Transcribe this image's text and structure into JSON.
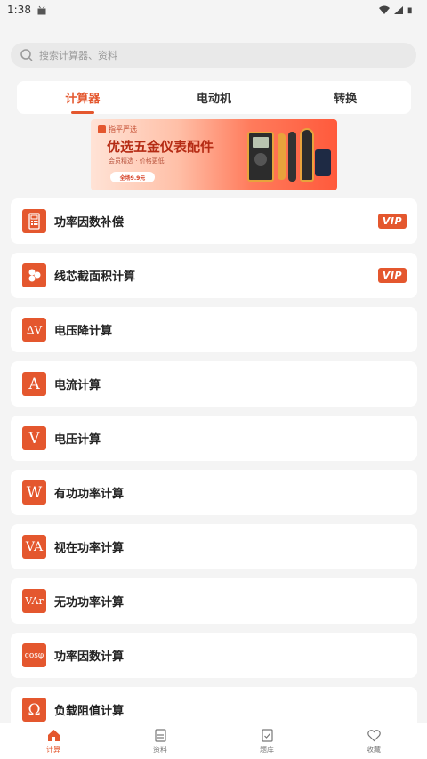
{
  "status": {
    "time": "1:38"
  },
  "search": {
    "placeholder": "搜索计算器、资料"
  },
  "tabs": [
    {
      "label": "计算器",
      "active": true
    },
    {
      "label": "电动机",
      "active": false
    },
    {
      "label": "转换",
      "active": false
    }
  ],
  "banner": {
    "tag": "指平严选",
    "title": "优选五金仪表配件",
    "subtitle": "会员精选 · 价格更低",
    "button": "全场9.9元"
  },
  "calculators": [
    {
      "label": "功率因数补偿",
      "icon": "phone-calc-icon",
      "icon_text": "",
      "vip": "VIP"
    },
    {
      "label": "线芯截面积计算",
      "icon": "wire-cores-icon",
      "icon_text": "",
      "vip": "VIP"
    },
    {
      "label": "电压降计算",
      "icon": "voltage-drop-icon",
      "icon_text": "ΔV",
      "vip": ""
    },
    {
      "label": "电流计算",
      "icon": "current-icon",
      "icon_text": "A",
      "vip": ""
    },
    {
      "label": "电压计算",
      "icon": "voltage-icon",
      "icon_text": "V",
      "vip": ""
    },
    {
      "label": "有功功率计算",
      "icon": "watt-icon",
      "icon_text": "W",
      "vip": ""
    },
    {
      "label": "视在功率计算",
      "icon": "va-icon",
      "icon_text": "VA",
      "vip": ""
    },
    {
      "label": "无功功率计算",
      "icon": "var-icon",
      "icon_text": "VAr",
      "vip": ""
    },
    {
      "label": "功率因数计算",
      "icon": "cos-phi-icon",
      "icon_text": "cosφ",
      "vip": ""
    },
    {
      "label": "负载阻值计算",
      "icon": "ohm-icon",
      "icon_text": "Ω",
      "vip": ""
    }
  ],
  "nav": [
    {
      "label": "计算",
      "active": true
    },
    {
      "label": "资料",
      "active": false
    },
    {
      "label": "题库",
      "active": false
    },
    {
      "label": "收藏",
      "active": false
    }
  ],
  "colors": {
    "accent": "#e4572e",
    "background": "#f4f4f4"
  }
}
